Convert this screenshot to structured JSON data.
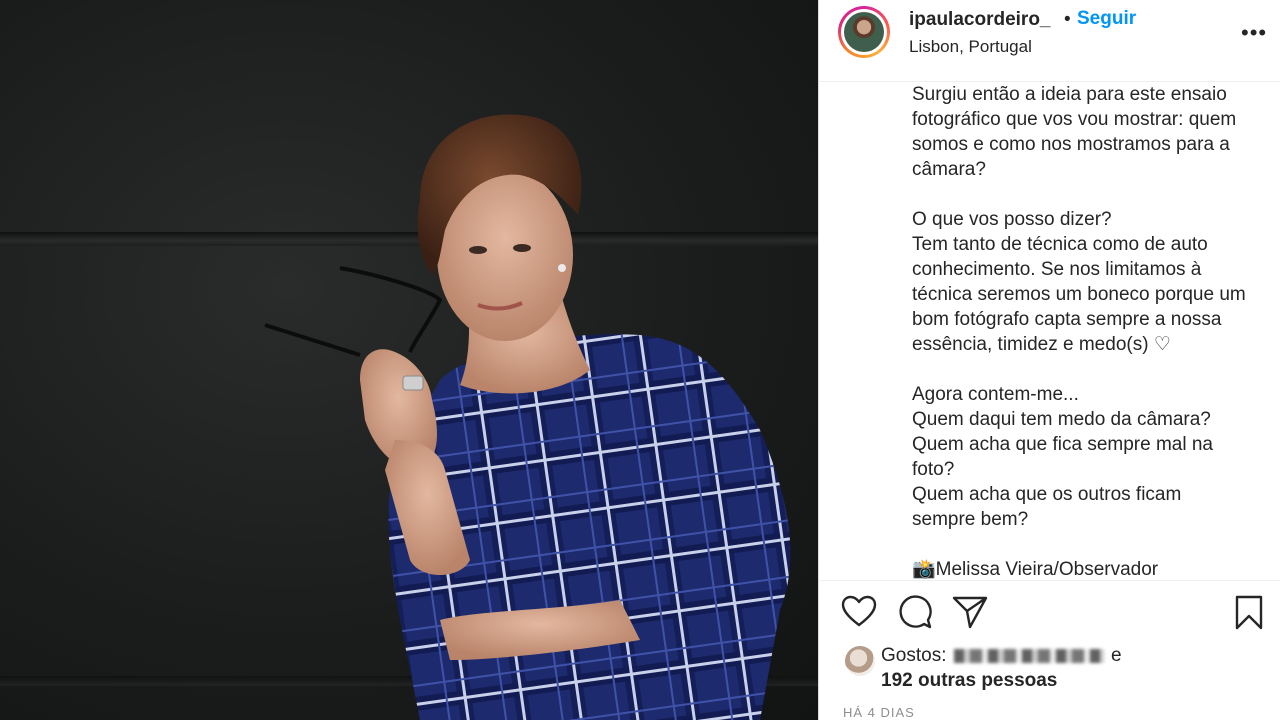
{
  "header": {
    "username": "ipaulacordeiro_",
    "separator": "•",
    "follow_label": "Seguir",
    "location": "Lisbon, Portugal",
    "more_label": "•••"
  },
  "caption": {
    "paragraphs": [
      [
        "Surgiu então a ideia para este ensaio",
        "fotográfico que vos vou mostrar: quem",
        "somos e como nos mostramos para a",
        "câmara?"
      ],
      [
        "O que vos posso dizer?",
        "Tem tanto de técnica como de auto",
        "conhecimento. Se nos limitamos à",
        "técnica seremos um boneco porque um",
        "bom fotógrafo capta sempre a nossa",
        "essência, timidez e medo(s) ♡"
      ],
      [
        "Agora contem-me...",
        "Quem daqui tem medo da câmara?",
        "Quem acha que fica sempre mal na",
        "foto?",
        "Quem acha que os outros ficam",
        "sempre bem?"
      ],
      [
        "📸Melissa Vieira/Observador"
      ]
    ]
  },
  "actions": {
    "like_icon": "heart-icon",
    "comment_icon": "comment-icon",
    "share_icon": "paper-plane-icon",
    "save_icon": "bookmark-icon"
  },
  "likes": {
    "prefix": "Gostos:",
    "suffix": "e",
    "count_text": "192 outras pessoas"
  },
  "timestamp": "HÁ 4 DIAS",
  "colors": {
    "follow": "#0095f6",
    "text": "#262626",
    "muted": "#8e8e8e",
    "shirt": "#1e2b6e"
  }
}
